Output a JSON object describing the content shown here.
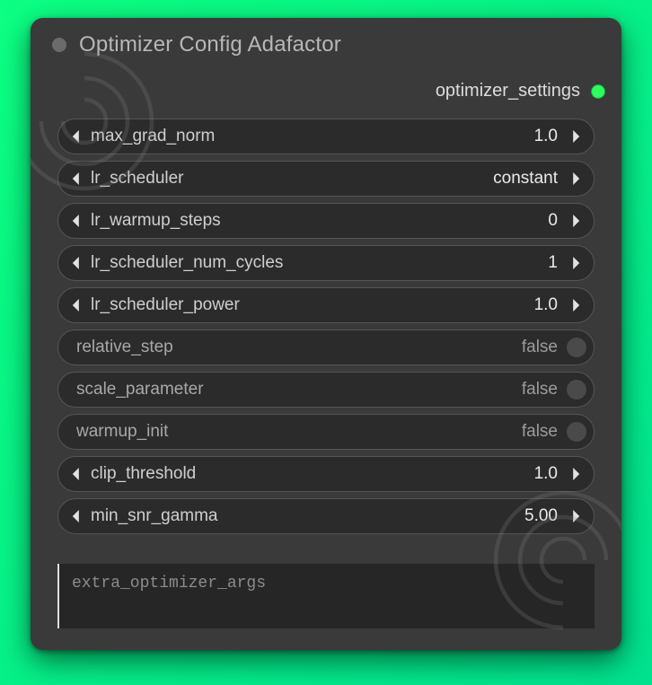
{
  "title": "Optimizer Config Adafactor",
  "output_label": "optimizer_settings",
  "fields": [
    {
      "name": "max_grad_norm",
      "value": "1.0",
      "kind": "num"
    },
    {
      "name": "lr_scheduler",
      "value": "constant",
      "kind": "enum"
    },
    {
      "name": "lr_warmup_steps",
      "value": "0",
      "kind": "num"
    },
    {
      "name": "lr_scheduler_num_cycles",
      "value": "1",
      "kind": "num"
    },
    {
      "name": "lr_scheduler_power",
      "value": "1.0",
      "kind": "num"
    },
    {
      "name": "relative_step",
      "value": "false",
      "kind": "toggle"
    },
    {
      "name": "scale_parameter",
      "value": "false",
      "kind": "toggle"
    },
    {
      "name": "warmup_init",
      "value": "false",
      "kind": "toggle"
    },
    {
      "name": "clip_threshold",
      "value": "1.0",
      "kind": "num"
    },
    {
      "name": "min_snr_gamma",
      "value": "5.00",
      "kind": "num"
    }
  ],
  "extra_field_placeholder": "extra_optimizer_args"
}
